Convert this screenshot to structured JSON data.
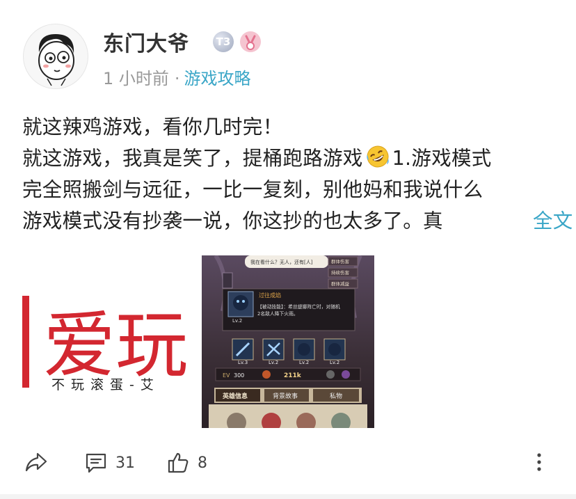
{
  "user": {
    "name": "东门大爷",
    "level_badge": "T3"
  },
  "meta": {
    "time": "1 小时前",
    "separator": "·",
    "topic": "游戏攻略"
  },
  "post": {
    "title": "就这辣鸡游戏，看你几时完！",
    "line2_a": "就这游戏，我真是笑了，提桶跑路游戏",
    "line2_b": "1.游戏模式",
    "line3": "完全照搬剑与远征，一比一复刻，别他妈和我说什么",
    "line4": "游戏模式没有抄袭一说，你这抄的也太多了。真",
    "more_label": "全文"
  },
  "images": {
    "left": {
      "brand": "爱玩",
      "slogan": "不玩滚蛋-艾"
    },
    "right": {
      "speech": "我在看什么？无人，还有[人]",
      "tags": [
        "群体伤害",
        "持续伤害",
        "群体减益"
      ],
      "skill_name": "过往成焰",
      "skill_desc_1": "【被动技能】：希丝缇娜阵亡时，对随机",
      "skill_desc_2": "2名敌人降下火雨。",
      "skill_level": "Lv.2",
      "skill_levels": [
        "Lv.3",
        "Lv.2",
        "Lv.2",
        "Lv.2"
      ],
      "ev": "EV",
      "ev_value": "300",
      "power": "211k",
      "tabs": [
        "英雄信息",
        "背景故事",
        "私物"
      ]
    }
  },
  "actions": {
    "comments": "31",
    "likes": "8"
  }
}
